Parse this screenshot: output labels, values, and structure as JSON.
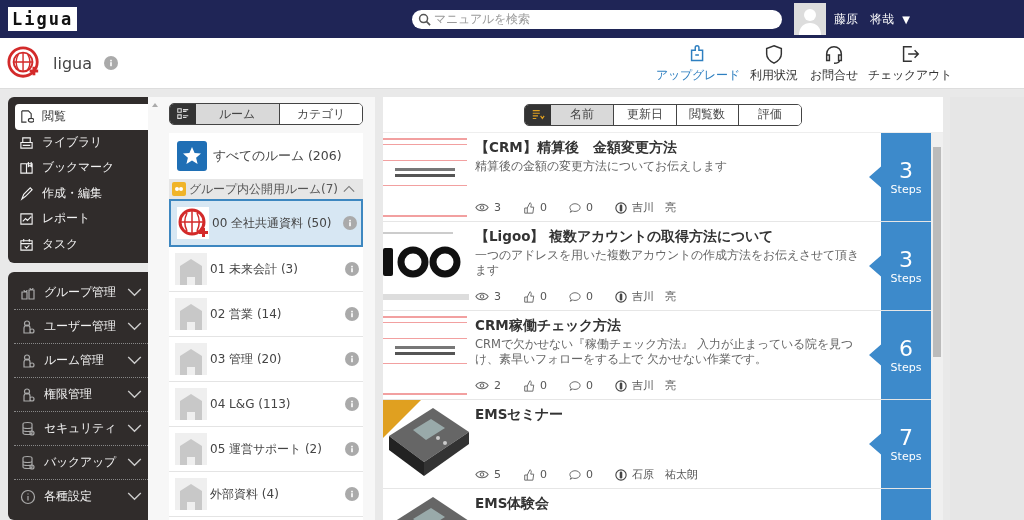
{
  "header": {
    "logo": "Ligua",
    "search": {
      "placeholder": "マニュアルを検索"
    },
    "user": {
      "name": "藤原　将哉",
      "caret": "▼"
    }
  },
  "workspace": {
    "name": "ligua"
  },
  "actions": [
    {
      "label": "アップグレード",
      "kind": "puzzle",
      "highlighted": true
    },
    {
      "label": "利用状況",
      "kind": "shield",
      "highlighted": false
    },
    {
      "label": "お問合せ",
      "kind": "headset",
      "highlighted": false
    },
    {
      "label": "チェックアウト",
      "kind": "exit",
      "highlighted": false
    }
  ],
  "menu": [
    {
      "label": "閲覧",
      "kind": "view",
      "selected": true
    },
    {
      "label": "ライブラリ",
      "kind": "library",
      "selected": false
    },
    {
      "label": "ブックマーク",
      "kind": "bookmark",
      "selected": false
    },
    {
      "label": "作成・編集",
      "kind": "pen",
      "selected": false
    },
    {
      "label": "レポート",
      "kind": "chart",
      "selected": false
    },
    {
      "label": "タスク",
      "kind": "calendar",
      "selected": false
    }
  ],
  "admin_menu": [
    {
      "label": "グループ管理",
      "kind": "people",
      "expanded": false
    },
    {
      "label": "ユーザー管理",
      "kind": "gearperson",
      "expanded": false
    },
    {
      "label": "ルーム管理",
      "kind": "gearperson",
      "expanded": false
    },
    {
      "label": "権限管理",
      "kind": "gearperson",
      "expanded": false
    },
    {
      "label": "セキュリティ",
      "kind": "database",
      "expanded": false
    },
    {
      "label": "バックアップ",
      "kind": "database",
      "expanded": false
    },
    {
      "label": "各種設定",
      "kind": "info",
      "expanded": false
    }
  ],
  "room_tabs": [
    {
      "label": "ルーム",
      "selected": true
    },
    {
      "label": "カテゴリ",
      "selected": false
    }
  ],
  "all_rooms": "すべてのルーム (206)",
  "room_group": {
    "label": "グループ内公開用ルーム(7)",
    "expanded": true
  },
  "rooms": [
    {
      "label": "00 全社共通資料 (50)",
      "kind": "logo",
      "selected": true
    },
    {
      "label": "01 未来会計 (3)",
      "kind": "house",
      "selected": false
    },
    {
      "label": "02 営業 (14)",
      "kind": "house",
      "selected": false
    },
    {
      "label": "03 管理 (20)",
      "kind": "house",
      "selected": false
    },
    {
      "label": "04 L&G (113)",
      "kind": "house",
      "selected": false
    },
    {
      "label": "05 運営サポート (2)",
      "kind": "house",
      "selected": false
    },
    {
      "label": "外部資料 (4)",
      "kind": "house",
      "selected": false
    }
  ],
  "sort_tabs": [
    {
      "label": "名前",
      "selected": true
    },
    {
      "label": "更新日",
      "selected": false
    },
    {
      "label": "閲覧数",
      "selected": false
    },
    {
      "label": "評価",
      "selected": false
    }
  ],
  "manuals": [
    {
      "title": "【CRM】精算後　金額変更方法",
      "description": "精算後の金額の変更方法についてお伝えします",
      "views": "3",
      "likes": "0",
      "comments": "0",
      "author": "吉川　亮",
      "steps": "3",
      "steps_label": "Steps",
      "new_badge": false
    },
    {
      "title": "【Ligoo】 複数アカウントの取得方法について",
      "description": "一つのアドレスを用いた複数アカウントの作成方法をお伝えさせて頂きます",
      "views": "3",
      "likes": "0",
      "comments": "0",
      "author": "吉川　亮",
      "steps": "3",
      "steps_label": "Steps",
      "new_badge": false
    },
    {
      "title": "CRM稼働チェック方法",
      "description": "CRMで欠かせない『稼働チェック方法』 入力が止まっている院を見つけ、素早いフォローをする上で 欠かせない作業です。",
      "views": "2",
      "likes": "0",
      "comments": "0",
      "author": "吉川　亮",
      "steps": "6",
      "steps_label": "Steps",
      "new_badge": false
    },
    {
      "title": "EMSセミナー",
      "views": "5",
      "likes": "0",
      "comments": "0",
      "author": "石原　祐太朗",
      "steps": "7",
      "steps_label": "Steps",
      "new_badge": true
    },
    {
      "title": "EMS体験会",
      "new_badge": false
    }
  ]
}
